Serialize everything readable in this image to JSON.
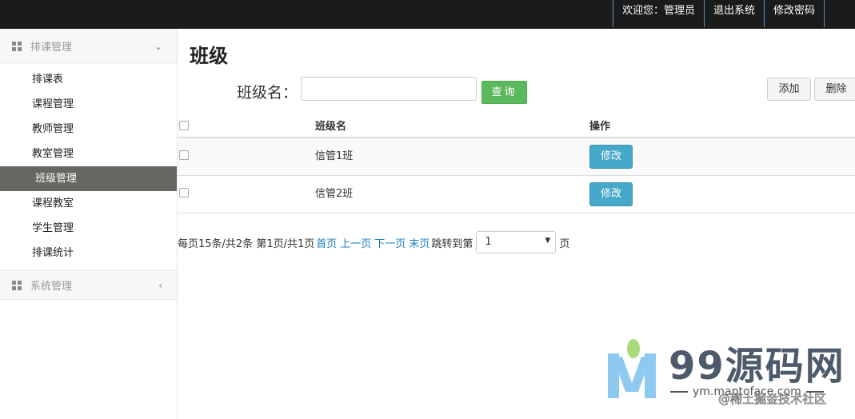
{
  "topbar": {
    "welcome": "欢迎您：管理员",
    "logout": "退出系统",
    "change_password": "修改密码"
  },
  "sidebar": {
    "group1": {
      "label": "排课管理",
      "icon": "grid-icon",
      "arrow": "chevron-down-icon",
      "items": [
        {
          "label": "排课表"
        },
        {
          "label": "课程管理"
        },
        {
          "label": "教师管理"
        },
        {
          "label": "教室管理"
        },
        {
          "label": "班级管理",
          "active": true
        },
        {
          "label": "课程教室"
        },
        {
          "label": "学生管理"
        },
        {
          "label": "排课统计"
        }
      ]
    },
    "group2": {
      "label": "系统管理",
      "icon": "grid-icon",
      "arrow": "chevron-left-icon"
    }
  },
  "main": {
    "title": "班级",
    "search_label": "班级名：",
    "search_value": "",
    "query_button": "查询",
    "add_button": "添加",
    "delete_button": "删除"
  },
  "table": {
    "headers": [
      "",
      "班级名",
      "操作"
    ],
    "rows": [
      {
        "name": "信管1班",
        "action": "修改"
      },
      {
        "name": "信管2班",
        "action": "修改"
      }
    ]
  },
  "pager": {
    "summary": "每页15条/共2条 第1页/共1页",
    "first": "首页",
    "prev": "上一页",
    "next": "下一页",
    "last": "末页",
    "jump_label": "跳转到第",
    "page_select": "1",
    "page_suffix": "页"
  },
  "watermark": {
    "brand": "99源码网",
    "url": "ym.maptoface.com",
    "credit": "@稀土掘金技术社区"
  },
  "colors": {
    "topbar_bg": "#1b1b1b",
    "active_menu_bg": "#666662",
    "query_button": "#5cb85c",
    "edit_button": "#46a8c8",
    "link": "#1f7fc0"
  }
}
